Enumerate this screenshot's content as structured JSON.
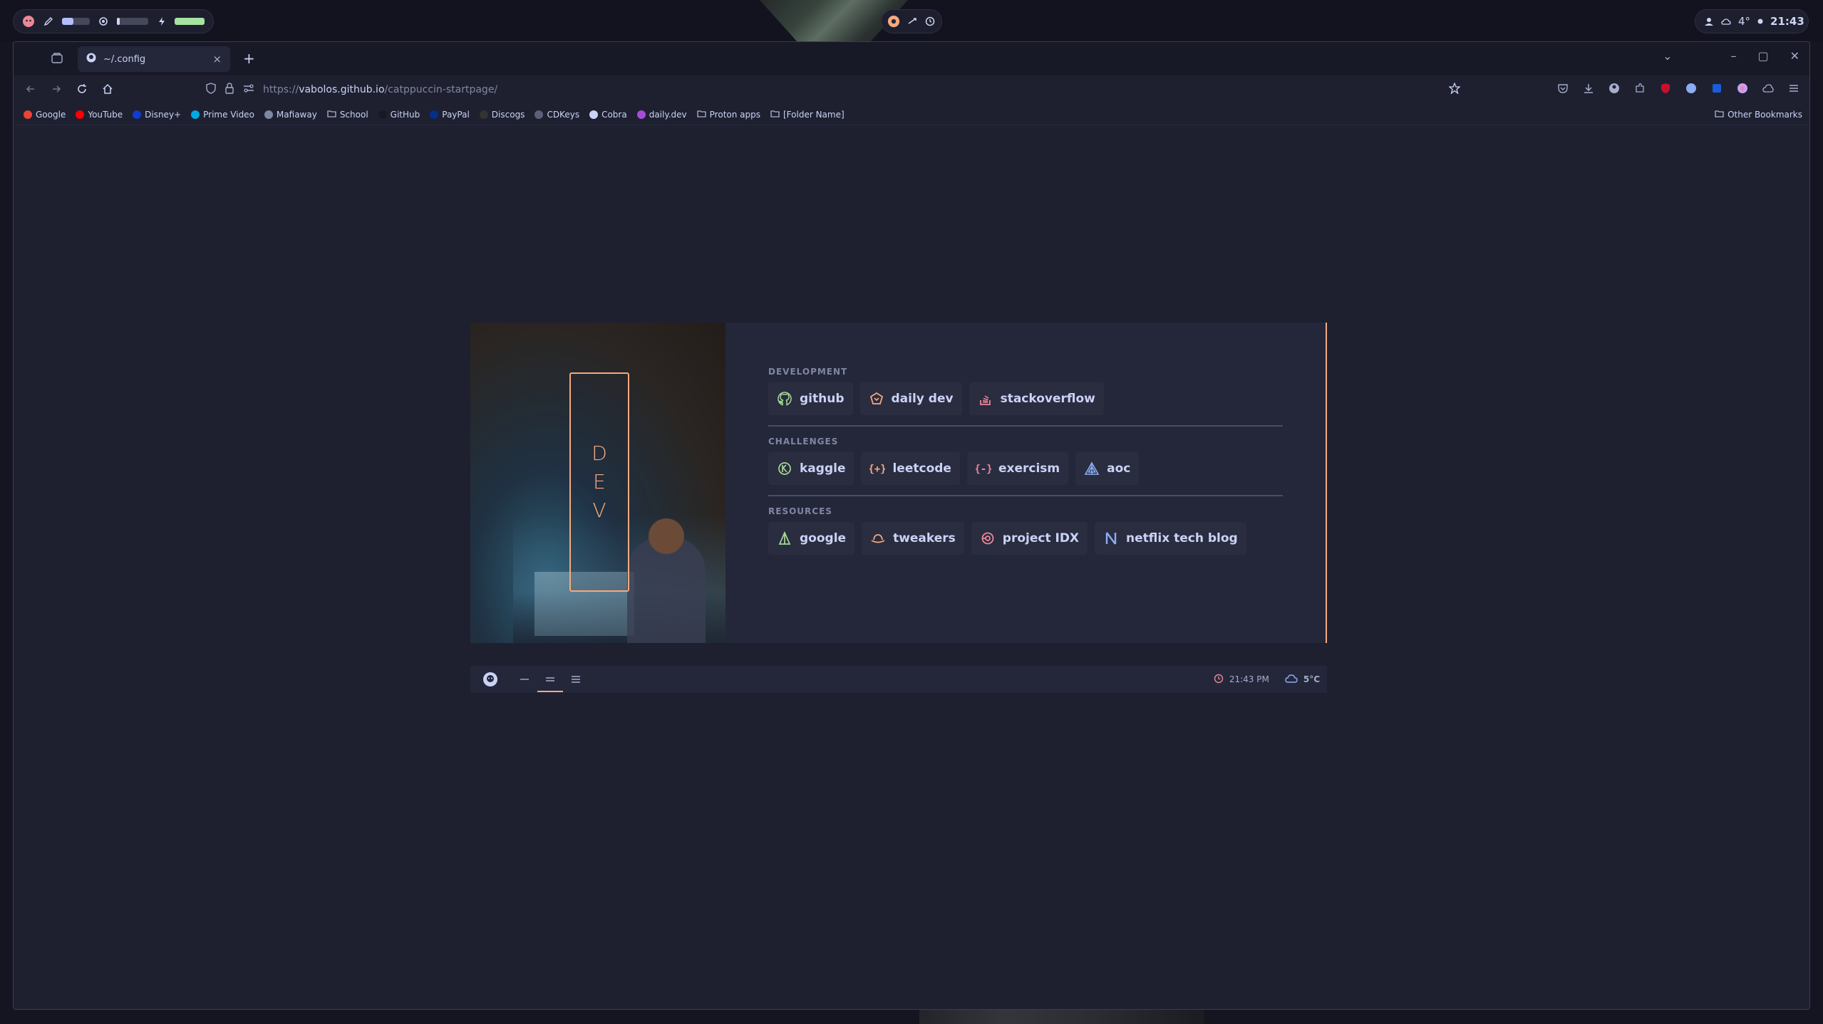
{
  "desktop": {
    "clock": "21:43",
    "weather": "4°",
    "weather_icon": "cloud-icon",
    "colors": {
      "bar_bg": "#12131e",
      "accent_green": "#a6e3a1",
      "accent_lavender": "#b4befe"
    }
  },
  "browser": {
    "tab": {
      "title": "~/.config",
      "close": "×",
      "new_tab": "+"
    },
    "window_controls": {
      "list": "⌄",
      "minimize": "–",
      "maximize": "▢",
      "close": "✕"
    },
    "url": {
      "prefix": "https://",
      "host": "vabolos.github.io",
      "path": "/catppuccin-startpage/"
    },
    "bookmarks": [
      {
        "label": "Google",
        "icon": "google-icon",
        "color": "#ea4335"
      },
      {
        "label": "YouTube",
        "icon": "youtube-icon",
        "color": "#ff0000"
      },
      {
        "label": "Disney+",
        "icon": "disney-icon",
        "color": "#113ccf"
      },
      {
        "label": "Prime Video",
        "icon": "prime-video-icon",
        "color": "#00a8e1"
      },
      {
        "label": "Mafiaway",
        "icon": "mafiaway-icon",
        "color": "#8087a2"
      },
      {
        "label": "School",
        "icon": "folder-icon",
        "color": ""
      },
      {
        "label": "GitHub",
        "icon": "github-icon",
        "color": "#181926"
      },
      {
        "label": "PayPal",
        "icon": "paypal-icon",
        "color": "#003087"
      },
      {
        "label": "Discogs",
        "icon": "discogs-icon",
        "color": "#333333"
      },
      {
        "label": "CDKeys",
        "icon": "cdkeys-icon",
        "color": "#5b6078"
      },
      {
        "label": "Cobra",
        "icon": "cobra-icon",
        "color": "#cad3f5"
      },
      {
        "label": "daily.dev",
        "icon": "dailydev-icon",
        "color": "#a54cd8"
      },
      {
        "label": "Proton apps",
        "icon": "folder-icon",
        "color": ""
      },
      {
        "label": "[Folder Name]",
        "icon": "folder-icon",
        "color": ""
      }
    ],
    "other_bookmarks": "Other Bookmarks"
  },
  "startpage": {
    "banner_letters": [
      "D",
      "E",
      "V"
    ],
    "sections": [
      {
        "title": "DEVELOPMENT",
        "links": [
          {
            "label": "github",
            "icon": "github-icon",
            "color": "#a6da95"
          },
          {
            "label": "daily dev",
            "icon": "dailydev-icon",
            "color": "#f5a97f"
          },
          {
            "label": "stackoverflow",
            "icon": "stackoverflow-icon",
            "color": "#ed8796"
          }
        ]
      },
      {
        "title": "CHALLENGES",
        "links": [
          {
            "label": "kaggle",
            "icon": "kaggle-icon",
            "color": "#a6da95"
          },
          {
            "label": "leetcode",
            "icon": "leetcode-icon",
            "color": "#f5a97f"
          },
          {
            "label": "exercism",
            "icon": "exercism-icon",
            "color": "#ed8796"
          },
          {
            "label": "aoc",
            "icon": "aoc-icon",
            "color": "#8aadf4"
          }
        ]
      },
      {
        "title": "RESOURCES",
        "links": [
          {
            "label": "google",
            "icon": "google-icon",
            "color": "#a6da95"
          },
          {
            "label": "tweakers",
            "icon": "tweakers-icon",
            "color": "#f5a97f"
          },
          {
            "label": "project IDX",
            "icon": "project-idx-icon",
            "color": "#ed8796"
          },
          {
            "label": "netflix tech blog",
            "icon": "netflix-icon",
            "color": "#8aadf4"
          }
        ]
      }
    ],
    "footer": {
      "time": "21:43 PM",
      "weather": "5°C",
      "accent": "#f5a97f"
    }
  }
}
